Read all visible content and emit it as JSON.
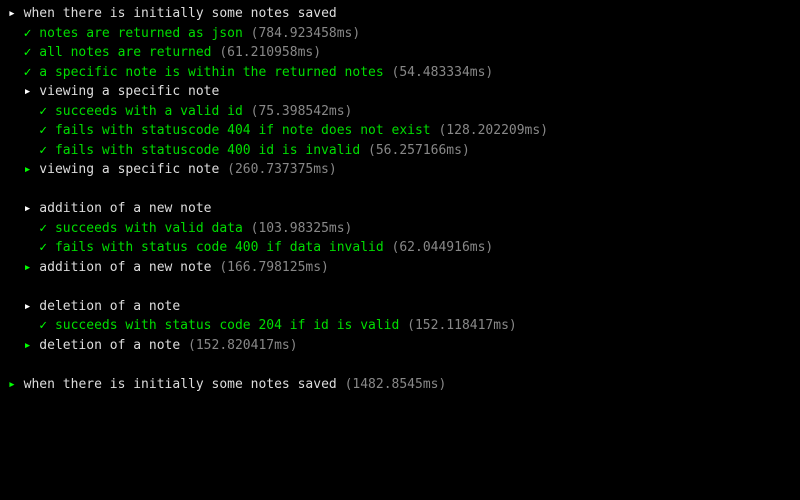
{
  "glyphs": {
    "arrow": "▸",
    "check": "✓"
  },
  "lines": [
    {
      "type": "suite",
      "indent": 0,
      "arrowColor": "white",
      "text": "when there is initially some notes saved"
    },
    {
      "type": "pass",
      "indent": 1,
      "text": "notes are returned as json",
      "dur": "784.923458ms"
    },
    {
      "type": "pass",
      "indent": 1,
      "text": "all notes are returned",
      "dur": "61.210958ms"
    },
    {
      "type": "pass",
      "indent": 1,
      "text": "a specific note is within the returned notes",
      "dur": "54.483334ms"
    },
    {
      "type": "suite",
      "indent": 1,
      "arrowColor": "white",
      "text": "viewing a specific note"
    },
    {
      "type": "pass",
      "indent": 2,
      "text": "succeeds with a valid id",
      "dur": "75.398542ms"
    },
    {
      "type": "pass",
      "indent": 2,
      "text": "fails with statuscode 404 if note does not exist",
      "dur": "128.202209ms"
    },
    {
      "type": "pass",
      "indent": 2,
      "text": "fails with statuscode 400 id is invalid",
      "dur": "56.257166ms"
    },
    {
      "type": "suite-end",
      "indent": 1,
      "arrowColor": "green",
      "text": "viewing a specific note",
      "dur": "260.737375ms"
    },
    {
      "type": "blank"
    },
    {
      "type": "suite",
      "indent": 1,
      "arrowColor": "white",
      "text": "addition of a new note"
    },
    {
      "type": "pass",
      "indent": 2,
      "text": "succeeds with valid data",
      "dur": "103.98325ms"
    },
    {
      "type": "pass",
      "indent": 2,
      "text": "fails with status code 400 if data invalid",
      "dur": "62.044916ms"
    },
    {
      "type": "suite-end",
      "indent": 1,
      "arrowColor": "green",
      "text": "addition of a new note",
      "dur": "166.798125ms"
    },
    {
      "type": "blank"
    },
    {
      "type": "suite",
      "indent": 1,
      "arrowColor": "white",
      "text": "deletion of a note"
    },
    {
      "type": "pass",
      "indent": 2,
      "text": "succeeds with status code 204 if id is valid",
      "dur": "152.118417ms"
    },
    {
      "type": "suite-end",
      "indent": 1,
      "arrowColor": "green",
      "text": "deletion of a note",
      "dur": "152.820417ms"
    },
    {
      "type": "blank"
    },
    {
      "type": "suite-end",
      "indent": 0,
      "arrowColor": "green",
      "text": "when there is initially some notes saved",
      "dur": "1482.8545ms"
    }
  ]
}
